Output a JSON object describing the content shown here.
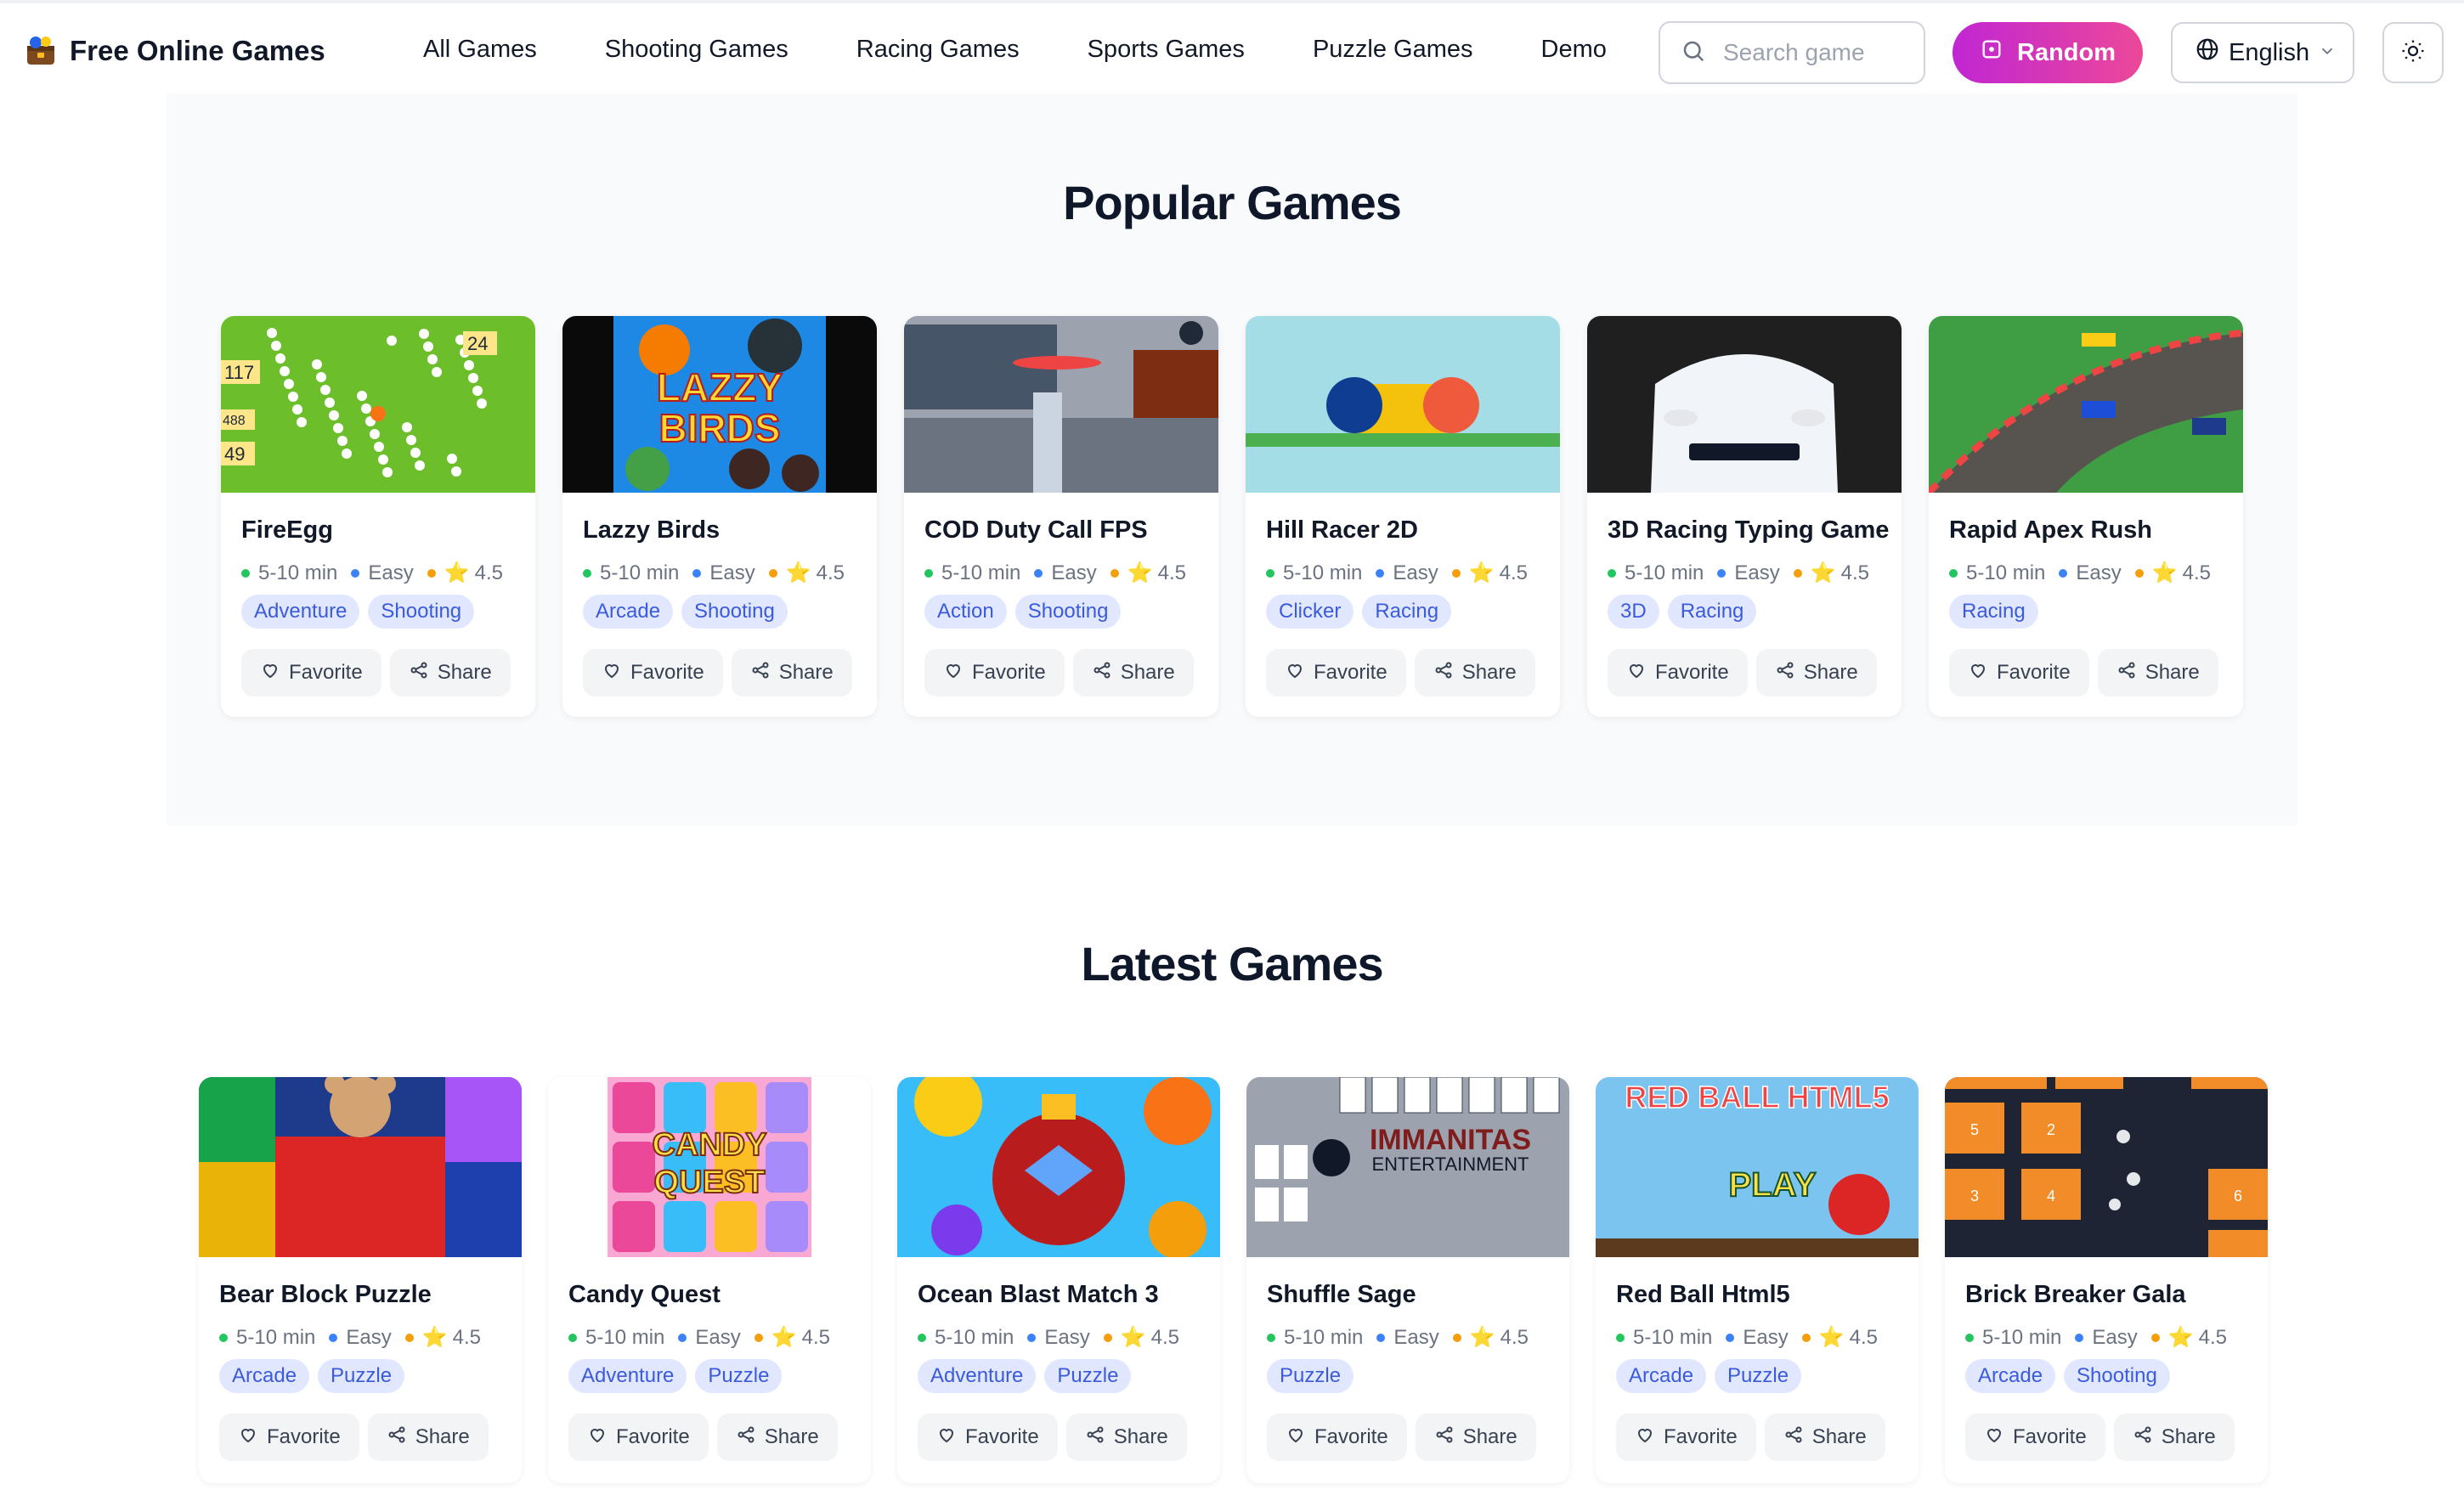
{
  "header": {
    "brand": "Free Online Games",
    "nav": [
      "All Games",
      "Shooting Games",
      "Racing Games",
      "Sports Games",
      "Puzzle Games",
      "Demo"
    ],
    "search_placeholder": "Search game",
    "random_label": "Random",
    "language": "English"
  },
  "popular": {
    "title": "Popular Games",
    "games": [
      {
        "name": "FireEgg",
        "time": "5-10 min",
        "difficulty": "Easy",
        "rating": "4.5",
        "tags": [
          "Adventure",
          "Shooting"
        ]
      },
      {
        "name": "Lazzy Birds",
        "time": "5-10 min",
        "difficulty": "Easy",
        "rating": "4.5",
        "tags": [
          "Arcade",
          "Shooting"
        ]
      },
      {
        "name": "COD Duty Call FPS",
        "time": "5-10 min",
        "difficulty": "Easy",
        "rating": "4.5",
        "tags": [
          "Action",
          "Shooting"
        ]
      },
      {
        "name": "Hill Racer 2D",
        "time": "5-10 min",
        "difficulty": "Easy",
        "rating": "4.5",
        "tags": [
          "Clicker",
          "Racing"
        ]
      },
      {
        "name": "3D Racing Typing Game",
        "time": "5-10 min",
        "difficulty": "Easy",
        "rating": "4.5",
        "tags": [
          "3D",
          "Racing"
        ]
      },
      {
        "name": "Rapid Apex Rush",
        "time": "5-10 min",
        "difficulty": "Easy",
        "rating": "4.5",
        "tags": [
          "Racing"
        ]
      }
    ]
  },
  "latest": {
    "title": "Latest Games",
    "games": [
      {
        "name": "Bear Block Puzzle",
        "time": "5-10 min",
        "difficulty": "Easy",
        "rating": "4.5",
        "tags": [
          "Arcade",
          "Puzzle"
        ]
      },
      {
        "name": "Candy Quest",
        "time": "5-10 min",
        "difficulty": "Easy",
        "rating": "4.5",
        "tags": [
          "Adventure",
          "Puzzle"
        ]
      },
      {
        "name": "Ocean Blast Match 3",
        "time": "5-10 min",
        "difficulty": "Easy",
        "rating": "4.5",
        "tags": [
          "Adventure",
          "Puzzle"
        ]
      },
      {
        "name": "Shuffle Sage",
        "time": "5-10 min",
        "difficulty": "Easy",
        "rating": "4.5",
        "tags": [
          "Puzzle"
        ]
      },
      {
        "name": "Red Ball Html5",
        "time": "5-10 min",
        "difficulty": "Easy",
        "rating": "4.5",
        "tags": [
          "Arcade",
          "Puzzle"
        ]
      },
      {
        "name": "Brick Breaker Gala",
        "time": "5-10 min",
        "difficulty": "Easy",
        "rating": "4.5",
        "tags": [
          "Arcade",
          "Shooting"
        ]
      }
    ]
  },
  "thumb_text": {
    "fireegg_nums": [
      "24",
      "117",
      "488",
      "49"
    ],
    "lazzy": [
      "LAZZY",
      "BIRDS"
    ],
    "candy": [
      "CANDY",
      "QUEST"
    ],
    "shuffle": "IMMANITAS",
    "shuffle_sub": "ENTERTAINMENT",
    "redball": "RED BALL HTML5",
    "play": "PLAY",
    "bricks": [
      "5",
      "2",
      "3",
      "4",
      "6"
    ]
  },
  "card_actions": {
    "favorite": "Favorite",
    "share": "Share"
  },
  "colors": {
    "accent_from": "#c026d3",
    "accent_to": "#ec4899",
    "tag_bg": "#e0e7ff",
    "tag_text": "#3b5bdb",
    "time_dot": "#22c55e",
    "difficulty_dot": "#3b82f6",
    "rating_dot": "#f59e0b"
  }
}
